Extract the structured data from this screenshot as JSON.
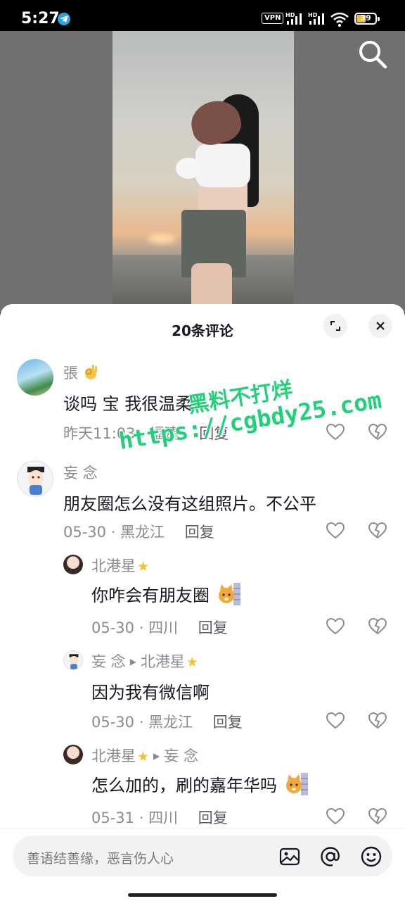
{
  "status_bar": {
    "time": "5:27",
    "vpn": "VPN",
    "battery": "39",
    "signal1_label": "HD",
    "signal2_label": "HD"
  },
  "sheet": {
    "title": "20条评论"
  },
  "comments": [
    {
      "name": "張",
      "text": "谈吗 宝 我很温柔",
      "date": "昨天11:03",
      "location": "福建",
      "reply": "回复"
    },
    {
      "name": "妄 念",
      "text": "朋友圈怎么没有这组照片。不公平",
      "date": "05-30",
      "location": "黑龙江",
      "reply": "回复"
    }
  ],
  "replies": [
    {
      "name": "北港星",
      "text": "你咋会有朋友圈",
      "date": "05-30",
      "location": "四川",
      "reply": "回复"
    },
    {
      "name": "妄 念",
      "reply_to": "北港星",
      "text": "因为我有微信啊",
      "date": "05-30",
      "location": "黑龙江",
      "reply": "回复"
    },
    {
      "name": "北港星",
      "reply_to": "妄 念",
      "text": "怎么加的，刷的嘉年华吗",
      "date": "05-31",
      "location": "四川",
      "reply": "回复"
    }
  ],
  "watermark": {
    "line1": "黑料不打烊",
    "line2": "https://cgbdy25.com"
  },
  "input": {
    "placeholder": "善语结善缘，恶言伤人心"
  },
  "colors": {
    "accent_star": "#f6c22c",
    "watermark": "#23d07a",
    "muted_text": "#8a8b91",
    "primary_text": "#161823"
  },
  "icons": [
    "search-icon",
    "expand-icon",
    "close-icon",
    "heart-icon",
    "broken-heart-icon",
    "image-icon",
    "at-icon",
    "emoji-icon"
  ]
}
